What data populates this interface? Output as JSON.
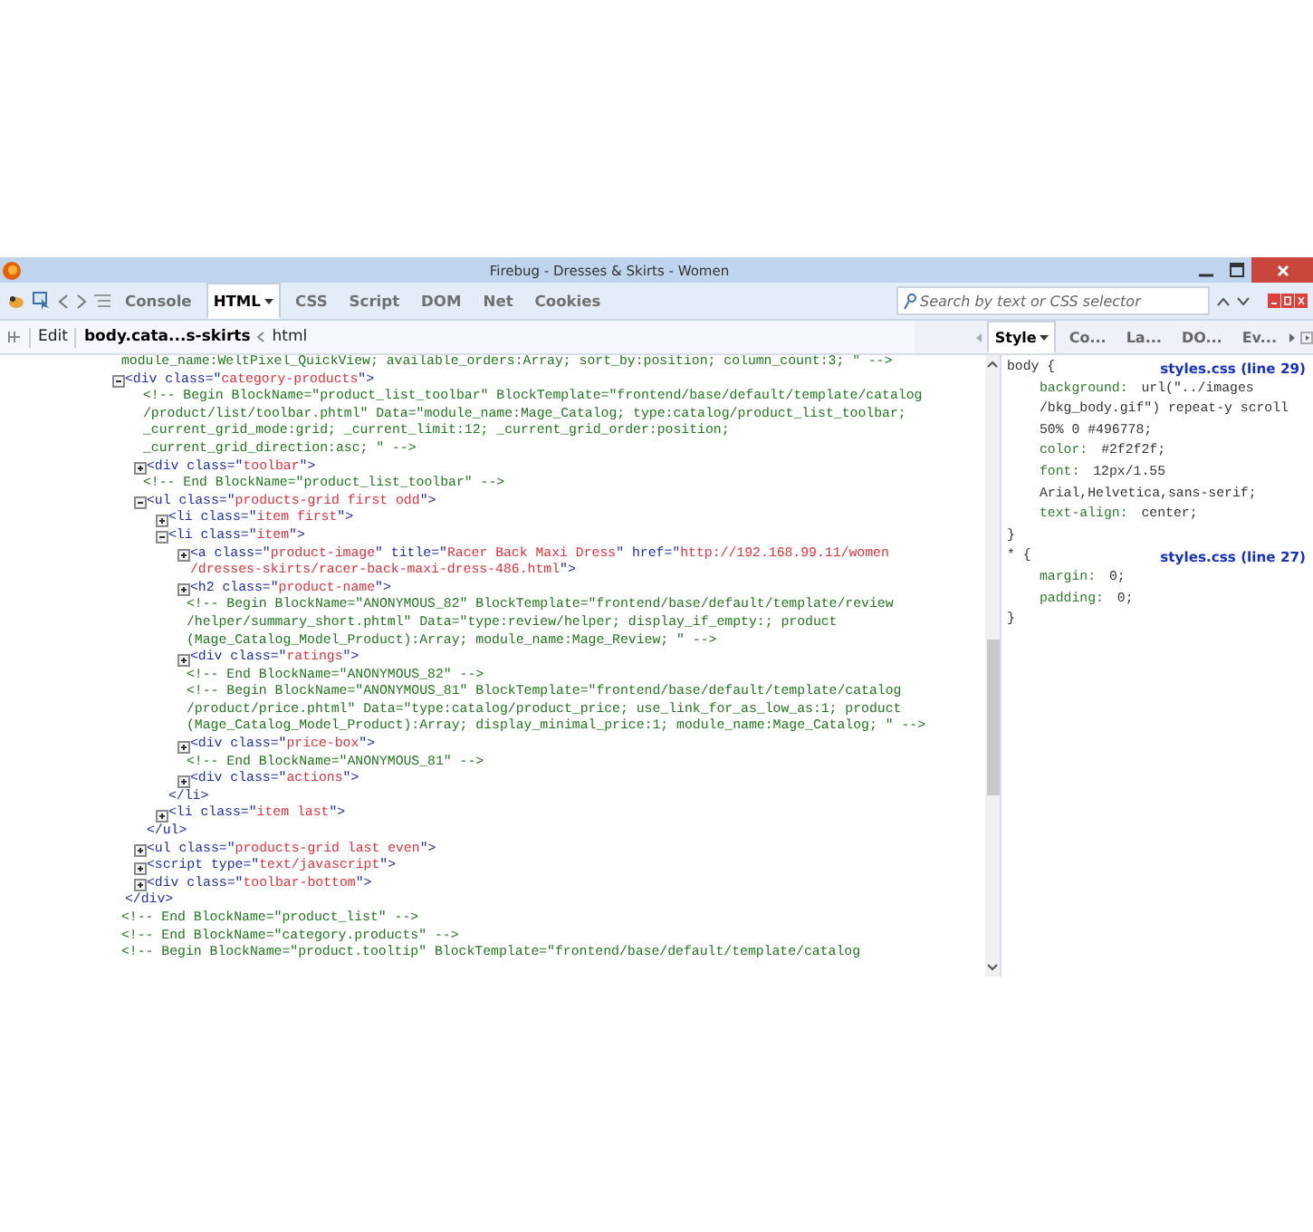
{
  "window": {
    "title": "Firebug - Dresses & Skirts - Women"
  },
  "toolbar": {
    "tabs": [
      {
        "label": "Console",
        "selected": false
      },
      {
        "label": "HTML",
        "selected": true
      },
      {
        "label": "CSS",
        "selected": false
      },
      {
        "label": "Script",
        "selected": false
      },
      {
        "label": "DOM",
        "selected": false
      },
      {
        "label": "Net",
        "selected": false
      },
      {
        "label": "Cookies",
        "selected": false
      }
    ],
    "search": {
      "placeholder": "Search by text or CSS selector"
    }
  },
  "breadcrumb": {
    "edit": "Edit",
    "items": [
      {
        "label": "body.cata...s-skirts",
        "selected": true
      },
      {
        "label": "html",
        "selected": false
      }
    ]
  },
  "html_tree": [
    {
      "kind": "comment",
      "lines": [
        "module_name:WeltPixel_QuickView; available_orders:Array; sort_by:position; column_count:3; \" -->"
      ]
    },
    {
      "kind": "element",
      "expanded": true,
      "open": [
        "<div class=\"category-products\">"
      ],
      "close": "</div>",
      "children": [
        {
          "kind": "comment",
          "lines": [
            "<!-- Begin BlockName=\"product_list_toolbar\" BlockTemplate=\"frontend/base/default/template/catalog",
            "/product/list/toolbar.phtml\" Data=\"module_name:Mage_Catalog; type:catalog/product_list_toolbar;",
            "_current_grid_mode:grid; _current_limit:12; _current_grid_order:position;",
            "_current_grid_direction:asc; \" -->"
          ]
        },
        {
          "kind": "element",
          "expanded": false,
          "open": [
            "<div class=\"toolbar\">"
          ]
        },
        {
          "kind": "comment",
          "lines": [
            "<!-- End BlockName=\"product_list_toolbar\" -->"
          ]
        },
        {
          "kind": "element",
          "expanded": true,
          "open": [
            "<ul class=\"products-grid first odd\">"
          ],
          "close": "</ul>",
          "children": [
            {
              "kind": "element",
              "expanded": false,
              "open": [
                "<li class=\"item first\">"
              ]
            },
            {
              "kind": "element",
              "expanded": true,
              "open": [
                "<li class=\"item\">"
              ],
              "close": "</li>",
              "children": [
                {
                  "kind": "element",
                  "expanded": false,
                  "open": [
                    "<a class=\"product-image\" title=\"Racer Back Maxi Dress\" href=\"http://192.168.99.11/women",
                    "/dresses-skirts/racer-back-maxi-dress-486.html\">"
                  ]
                },
                {
                  "kind": "element",
                  "expanded": false,
                  "open": [
                    "<h2 class=\"product-name\">"
                  ]
                },
                {
                  "kind": "comment",
                  "lines": [
                    "<!-- Begin BlockName=\"ANONYMOUS_82\" BlockTemplate=\"frontend/base/default/template/review",
                    "/helper/summary_short.phtml\" Data=\"type:review/helper; display_if_empty:; product",
                    "(Mage_Catalog_Model_Product):Array; module_name:Mage_Review; \" -->"
                  ]
                },
                {
                  "kind": "element",
                  "expanded": false,
                  "open": [
                    "<div class=\"ratings\">"
                  ]
                },
                {
                  "kind": "comment",
                  "lines": [
                    "<!-- End BlockName=\"ANONYMOUS_82\" -->"
                  ]
                },
                {
                  "kind": "comment",
                  "lines": [
                    "<!-- Begin BlockName=\"ANONYMOUS_81\" BlockTemplate=\"frontend/base/default/template/catalog",
                    "/product/price.phtml\" Data=\"type:catalog/product_price; use_link_for_as_low_as:1; product",
                    "(Mage_Catalog_Model_Product):Array; display_minimal_price:1; module_name:Mage_Catalog; \" -->"
                  ]
                },
                {
                  "kind": "element",
                  "expanded": false,
                  "open": [
                    "<div class=\"price-box\">"
                  ]
                },
                {
                  "kind": "comment",
                  "lines": [
                    "<!-- End BlockName=\"ANONYMOUS_81\" -->"
                  ]
                },
                {
                  "kind": "element",
                  "expanded": false,
                  "open": [
                    "<div class=\"actions\">"
                  ]
                }
              ]
            },
            {
              "kind": "element",
              "expanded": false,
              "open": [
                "<li class=\"item last\">"
              ]
            }
          ]
        },
        {
          "kind": "element",
          "expanded": false,
          "open": [
            "<ul class=\"products-grid last even\">"
          ]
        },
        {
          "kind": "element",
          "expanded": false,
          "open": [
            "<script type=\"text/javascript\">"
          ]
        },
        {
          "kind": "element",
          "expanded": false,
          "open": [
            "<div class=\"toolbar-bottom\">"
          ]
        }
      ]
    },
    {
      "kind": "comment",
      "lines": [
        "<!-- End BlockName=\"product_list\" -->"
      ]
    },
    {
      "kind": "comment",
      "lines": [
        "<!-- End BlockName=\"category.products\" -->"
      ]
    },
    {
      "kind": "comment",
      "lines": [
        "<!-- Begin BlockName=\"product.tooltip\" BlockTemplate=\"frontend/base/default/template/catalog"
      ]
    }
  ],
  "side_panel": {
    "tabs": [
      {
        "label": "Style",
        "selected": true
      },
      {
        "label": "Co...",
        "selected": false
      },
      {
        "label": "La...",
        "selected": false
      },
      {
        "label": "DO...",
        "selected": false
      },
      {
        "label": "Ev...",
        "selected": false
      }
    ],
    "rules": [
      {
        "selector": "body {",
        "source": "styles.css (line 29)",
        "close": "}",
        "props": [
          {
            "name": "background:",
            "value": [
              "url(\"../images",
              "/bkg_body.gif\") repeat-y scroll",
              "50% 0 #496778;"
            ]
          },
          {
            "name": "color:",
            "value": [
              "#2f2f2f;"
            ]
          },
          {
            "name": "font:",
            "value": [
              "12px/1.55",
              "Arial,Helvetica,sans-serif;"
            ]
          },
          {
            "name": "text-align:",
            "value": [
              "center;"
            ]
          }
        ]
      },
      {
        "selector": "* {",
        "source": "styles.css (line 27)",
        "close": "}",
        "props": [
          {
            "name": "margin:",
            "value": [
              "0;"
            ]
          },
          {
            "name": "padding:",
            "value": [
              "0;"
            ]
          }
        ]
      }
    ]
  }
}
